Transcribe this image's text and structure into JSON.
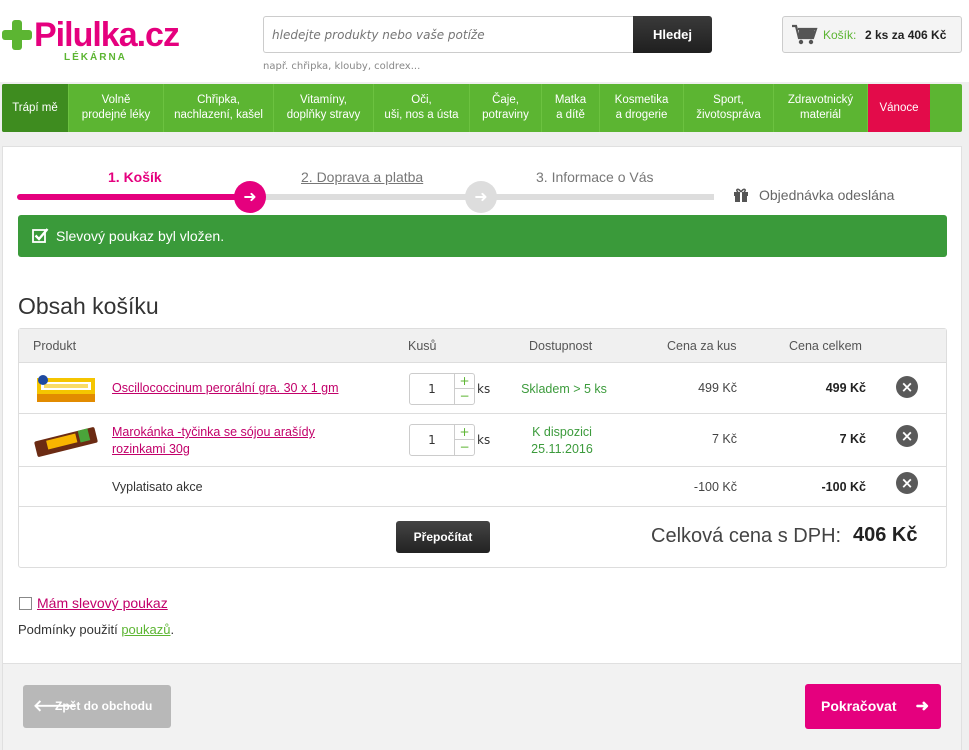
{
  "brand": {
    "name": "Pilulka.cz",
    "sub": "LÉKÁRNA",
    "color": "#e5007e",
    "accent": "#5cb532"
  },
  "search": {
    "placeholder": "hledejte produkty nebo vaše potíže",
    "button": "Hledej",
    "hint": "např. chřipka, klouby, coldrex..."
  },
  "cart": {
    "label": "Košík:",
    "summary": "2 ks za 406 Kč"
  },
  "nav": [
    {
      "label": "Trápí mě"
    },
    {
      "label": "Volně\nprodejné léky"
    },
    {
      "label": "Chřipka,\nnachlazení, kašel"
    },
    {
      "label": "Vitamíny,\ndoplňky stravy"
    },
    {
      "label": "Oči,\nuši, nos a ústa"
    },
    {
      "label": "Čaje,\npotraviny"
    },
    {
      "label": "Matka\na dítě"
    },
    {
      "label": "Kosmetika\na drogerie"
    },
    {
      "label": "Sport,\nživotospráva"
    },
    {
      "label": "Zdravotnický\nmateriál"
    },
    {
      "label": "Vánoce"
    }
  ],
  "steps": {
    "s1": "1. Košík",
    "s2": "2. Doprava a platba",
    "s3": "3. Informace o Vás",
    "s4": "Objednávka odeslána"
  },
  "alert": "Slevový poukaz byl vložen.",
  "section_title": "Obsah košíku",
  "table": {
    "headers": {
      "product": "Produkt",
      "qty": "Kusů",
      "availability": "Dostupnost",
      "unit_price": "Cena za kus",
      "total": "Cena celkem"
    },
    "rows": [
      {
        "name": "Oscillococcinum perorální gra. 30 x 1 gm",
        "qty": "1",
        "unit": "ks",
        "availability": "Skladem > 5 ks",
        "unit_price": "499 Kč",
        "total": "499 Kč"
      },
      {
        "name": "Marokánka -tyčinka se sójou arašídy rozinkami 30g",
        "qty": "1",
        "unit": "ks",
        "availability": "K dispozici 25.11.2016",
        "unit_price": "7 Kč",
        "total": "7 Kč"
      }
    ],
    "discount": {
      "label": "Vyplatisato akce",
      "unit_price": "-100 Kč",
      "total": "-100 Kč"
    }
  },
  "recalc_button": "Přepočítat",
  "grand_total": {
    "label": "Celková cena s DPH:",
    "value": "406 Kč"
  },
  "voucher": {
    "link": "Mám slevový poukaz"
  },
  "terms": {
    "text": "Podmínky použití ",
    "link": "poukazů",
    "end": "."
  },
  "buttons": {
    "back": "Zpět do obchodu",
    "next": "Pokračovat"
  }
}
